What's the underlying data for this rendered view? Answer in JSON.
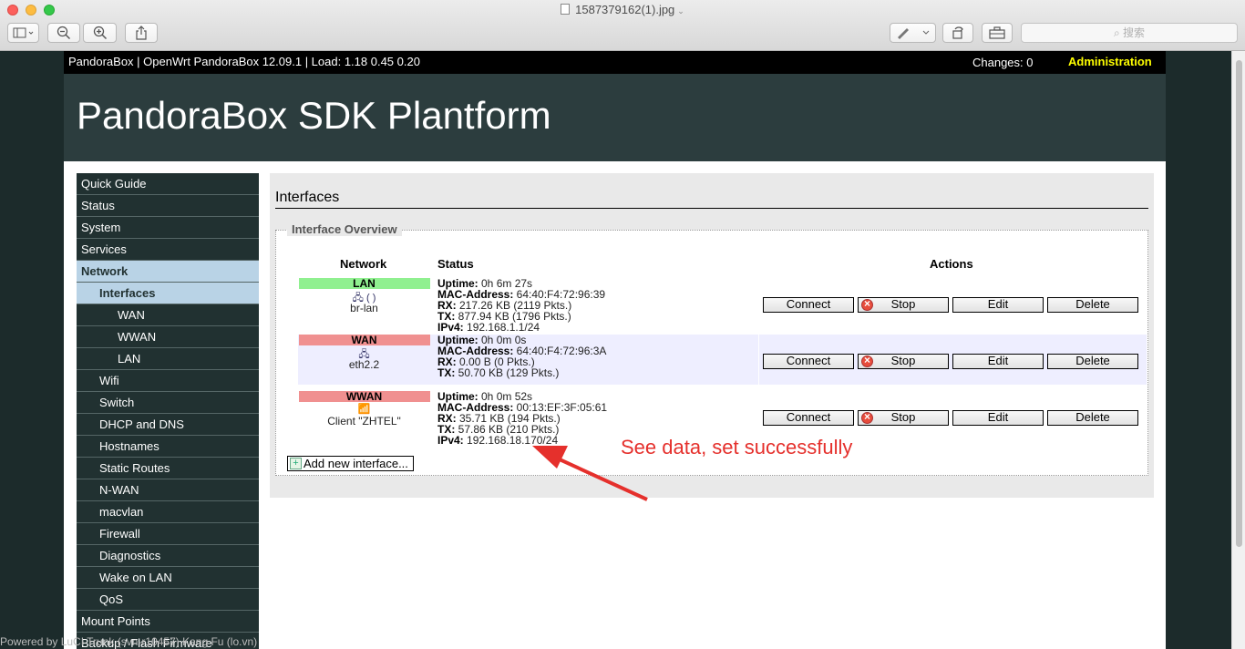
{
  "window": {
    "title": "1587379162(1).jpg",
    "search_placeholder": "搜索"
  },
  "router": {
    "topbar_info": "PandoraBox | OpenWrt PandoraBox 12.09.1 | Load: 1.18 0.45 0.20",
    "changes": "Changes: 0",
    "admin": "Administration",
    "title": "PandoraBox SDK Plantform"
  },
  "menu": [
    {
      "label": "Quick Guide",
      "level": 1
    },
    {
      "label": "Status",
      "level": 1
    },
    {
      "label": "System",
      "level": 1
    },
    {
      "label": "Services",
      "level": 1
    },
    {
      "label": "Network",
      "level": 1,
      "active": true
    },
    {
      "label": "Interfaces",
      "level": 2,
      "active": true
    },
    {
      "label": "WAN",
      "level": 3
    },
    {
      "label": "WWAN",
      "level": 3
    },
    {
      "label": "LAN",
      "level": 3
    },
    {
      "label": "Wifi",
      "level": 2
    },
    {
      "label": "Switch",
      "level": 2
    },
    {
      "label": "DHCP and DNS",
      "level": 2
    },
    {
      "label": "Hostnames",
      "level": 2
    },
    {
      "label": "Static Routes",
      "level": 2
    },
    {
      "label": "N-WAN",
      "level": 2
    },
    {
      "label": "macvlan",
      "level": 2
    },
    {
      "label": "Firewall",
      "level": 2
    },
    {
      "label": "Diagnostics",
      "level": 2
    },
    {
      "label": "Wake on LAN",
      "level": 2
    },
    {
      "label": "QoS",
      "level": 2
    },
    {
      "label": "Mount Points",
      "level": 1
    },
    {
      "label": "Backup / Flash Firmware",
      "level": 1
    }
  ],
  "content": {
    "heading": "Interfaces",
    "legend": "Interface Overview",
    "col_network": "Network",
    "col_status": "Status",
    "col_actions": "Actions",
    "add_button": "Add new interface...",
    "buttons": {
      "connect": "Connect",
      "stop": "Stop",
      "edit": "Edit",
      "delete": "Delete"
    },
    "interfaces": [
      {
        "name": "LAN",
        "color": "#90f090",
        "icons": "(  )",
        "device": "br-lan",
        "uptime_label": "Uptime:",
        "uptime": " 0h 6m 27s",
        "mac_label": "MAC-Address:",
        "mac": " 64:40:F4:72:96:39",
        "rx_label": "RX:",
        "rx": " 217.26 KB (2119 Pkts.)",
        "tx_label": "TX:",
        "tx": " 877.94 KB (1796 Pkts.)",
        "ipv4_label": "IPv4:",
        "ipv4": " 192.168.1.1/24"
      },
      {
        "name": "WAN",
        "color": "#f09090",
        "device": "eth2.2",
        "uptime_label": "Uptime:",
        "uptime": " 0h 0m 0s",
        "mac_label": "MAC-Address:",
        "mac": " 64:40:F4:72:96:3A",
        "rx_label": "RX:",
        "rx": " 0.00 B (0 Pkts.)",
        "tx_label": "TX:",
        "tx": " 50.70 KB (129 Pkts.)"
      },
      {
        "name": "WWAN",
        "color": "#f09090",
        "device": "Client \"ZHTEL\"",
        "uptime_label": "Uptime:",
        "uptime": " 0h 0m 52s",
        "mac_label": "MAC-Address:",
        "mac": " 00:13:EF:3F:05:61",
        "rx_label": "RX:",
        "rx": " 35.71 KB (194 Pkts.)",
        "tx_label": "TX:",
        "tx": " 57.86 KB (210 Pkts.)",
        "ipv4_label": "IPv4:",
        "ipv4": " 192.168.18.170/24"
      }
    ]
  },
  "annotation": {
    "text": "See data, set successfully",
    "color": "#e5302c"
  },
  "footer": "Powered by LuCI Trunk (svn-r10457) Kang Fu (lo.vn)"
}
